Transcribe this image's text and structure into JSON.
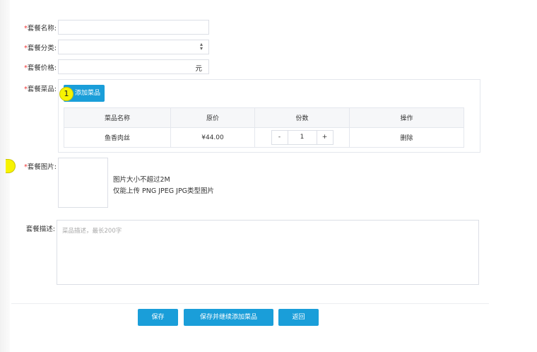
{
  "form": {
    "name_label": "套餐名称:",
    "category_label": "套餐分类:",
    "price_label": "套餐价格:",
    "price_unit": "元",
    "dishes_label": "套餐菜品:",
    "image_label": "套餐图片:",
    "desc_label": "套餐描述:",
    "required_mark": "*"
  },
  "dishes": {
    "add_button": "添加菜品",
    "badge": "1",
    "columns": [
      "菜品名称",
      "原价",
      "份数",
      "操作"
    ],
    "rows": [
      {
        "name": "鱼香肉丝",
        "price": "¥44.00",
        "qty": "1",
        "minus": "-",
        "plus": "+",
        "action": "删除"
      }
    ]
  },
  "image": {
    "hint1": "图片大小不超过2M",
    "hint2": "仅能上传 PNG JPEG JPG类型图片"
  },
  "description": {
    "placeholder": "菜品描述，最长200字"
  },
  "footer": {
    "save": "保存",
    "save_continue": "保存并继续添加菜品",
    "back": "返回"
  }
}
